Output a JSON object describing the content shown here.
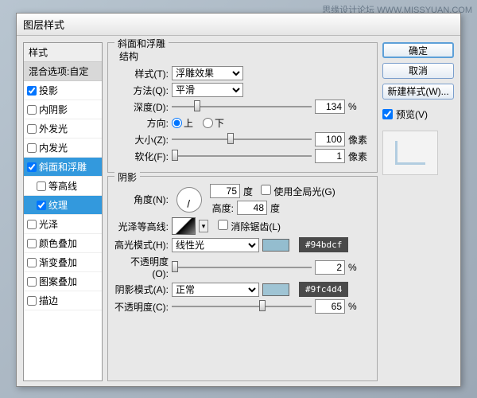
{
  "watermark": "思缘设计论坛  WWW.MISSYUAN.COM",
  "dialog_title": "图层样式",
  "sidebar": {
    "header": "样式",
    "blend": "混合选项:自定",
    "items": [
      {
        "label": "投影",
        "checked": true
      },
      {
        "label": "内阴影",
        "checked": false
      },
      {
        "label": "外发光",
        "checked": false
      },
      {
        "label": "内发光",
        "checked": false
      },
      {
        "label": "斜面和浮雕",
        "checked": true,
        "active": true
      },
      {
        "label": "等高线",
        "checked": false,
        "child": true
      },
      {
        "label": "纹理",
        "checked": true,
        "child": true,
        "active": true
      },
      {
        "label": "光泽",
        "checked": false
      },
      {
        "label": "颜色叠加",
        "checked": false
      },
      {
        "label": "渐变叠加",
        "checked": false
      },
      {
        "label": "图案叠加",
        "checked": false
      },
      {
        "label": "描边",
        "checked": false
      }
    ]
  },
  "panel": {
    "title": "斜面和浮雕",
    "structure": {
      "heading": "结构",
      "style_label": "样式(T):",
      "style_value": "浮雕效果",
      "technique_label": "方法(Q):",
      "technique_value": "平滑",
      "depth_label": "深度(D):",
      "depth_value": "134",
      "depth_unit": "%",
      "direction_label": "方向:",
      "dir_up": "上",
      "dir_down": "下",
      "size_label": "大小(Z):",
      "size_value": "100",
      "size_unit": "像素",
      "soften_label": "软化(F):",
      "soften_value": "1",
      "soften_unit": "像素"
    },
    "shading": {
      "heading": "阴影",
      "angle_label": "角度(N):",
      "angle_value": "75",
      "angle_unit": "度",
      "global_light": "使用全局光(G)",
      "altitude_label": "高度:",
      "altitude_value": "48",
      "altitude_unit": "度",
      "gloss_label": "光泽等高线:",
      "antialias": "消除锯齿(L)",
      "highlight_mode_label": "高光模式(H):",
      "highlight_mode_value": "线性光",
      "highlight_color": "#94bdcf",
      "highlight_tag": "#94bdcf",
      "highlight_opacity_label": "不透明度(O):",
      "highlight_opacity_value": "2",
      "highlight_opacity_unit": "%",
      "shadow_mode_label": "阴影模式(A):",
      "shadow_mode_value": "正常",
      "shadow_color": "#9fc4d4",
      "shadow_tag": "#9fc4d4",
      "shadow_opacity_label": "不透明度(C):",
      "shadow_opacity_value": "65",
      "shadow_opacity_unit": "%"
    }
  },
  "buttons": {
    "ok": "确定",
    "cancel": "取消",
    "new_style": "新建样式(W)...",
    "preview": "预览(V)"
  }
}
